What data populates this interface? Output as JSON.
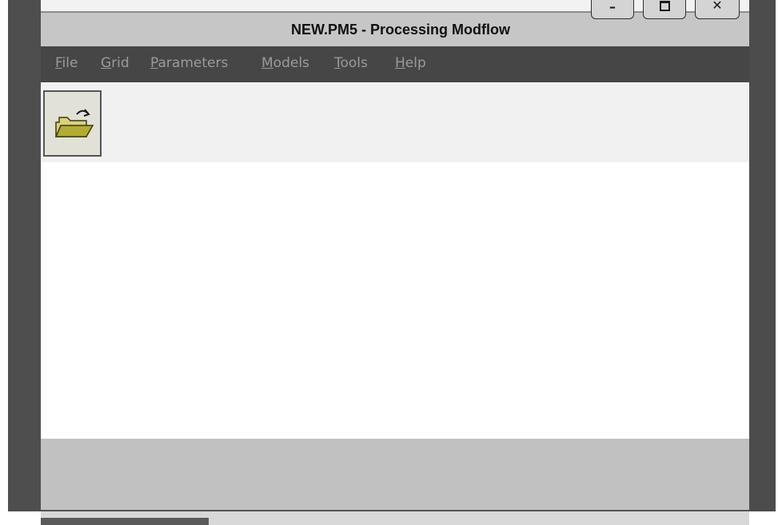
{
  "window": {
    "title": "NEW.PM5 - Processing Modflow",
    "controls": {
      "minimize": "–",
      "close": "✕"
    }
  },
  "menu": {
    "items": [
      {
        "label_ul": "F",
        "label_rest": "ile"
      },
      {
        "label_ul": "G",
        "label_rest": "rid"
      },
      {
        "label_ul": "P",
        "label_rest": "arameters"
      },
      {
        "label_ul": "M",
        "label_rest": "odels"
      },
      {
        "label_ul": "T",
        "label_rest": "ools"
      },
      {
        "label_ul": "H",
        "label_rest": "elp"
      }
    ]
  },
  "toolbar": {
    "open_icon": "open-folder-icon"
  },
  "colors": {
    "frame": "#4e4e4e",
    "menubar": "#464646",
    "menu_text": "#9a9a9a",
    "titlebar": "#c6c6c6",
    "status": "#c1c1c1",
    "folder_yellow": "#c8c248"
  }
}
